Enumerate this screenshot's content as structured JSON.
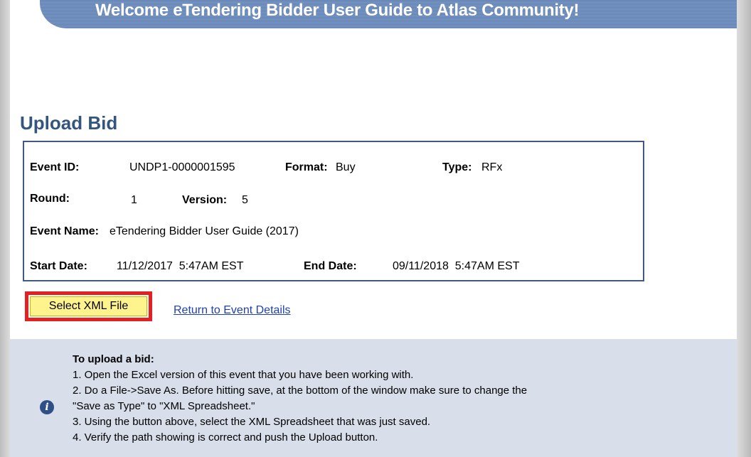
{
  "banner": {
    "text": "Welcome eTendering Bidder User Guide to Atlas Community!"
  },
  "page": {
    "title": "Upload Bid"
  },
  "event": {
    "event_id_label": "Event ID:",
    "event_id_value": "UNDP1-0000001595",
    "format_label": "Format:",
    "format_value": "Buy",
    "type_label": "Type:",
    "type_value": "RFx",
    "round_label": "Round:",
    "round_value": "1",
    "version_label": "Version:",
    "version_value": "5",
    "name_label": "Event Name:",
    "name_value": "eTendering Bidder User Guide (2017)",
    "start_label": "Start Date:",
    "start_value": "11/12/2017  5:47AM EST",
    "end_label": "End Date:",
    "end_value": "09/11/2018  5:47AM EST"
  },
  "actions": {
    "select_xml_label": "Select XML File",
    "return_link_label": "Return to Event Details"
  },
  "instructions": {
    "icon": "info-icon",
    "heading": "To upload a bid:",
    "steps": [
      "1. Open the Excel version of this event that you have been working with.",
      "2. Do a File->Save As. Before hitting save, at the bottom of the window make sure to change the",
      "\"Save as Type\" to \"XML Spreadsheet.\"",
      "3. Using the button above, select the XML Spreadsheet that was just saved.",
      "4. Verify the path showing is correct and push the Upload button."
    ]
  },
  "colors": {
    "banner": "#7f9bc7",
    "title": "#34557d",
    "box_border": "#3f5a84",
    "highlight": "#e32024",
    "button": "#fff38e",
    "link": "#1f3fb4",
    "instructions_bg": "#d8deea"
  }
}
